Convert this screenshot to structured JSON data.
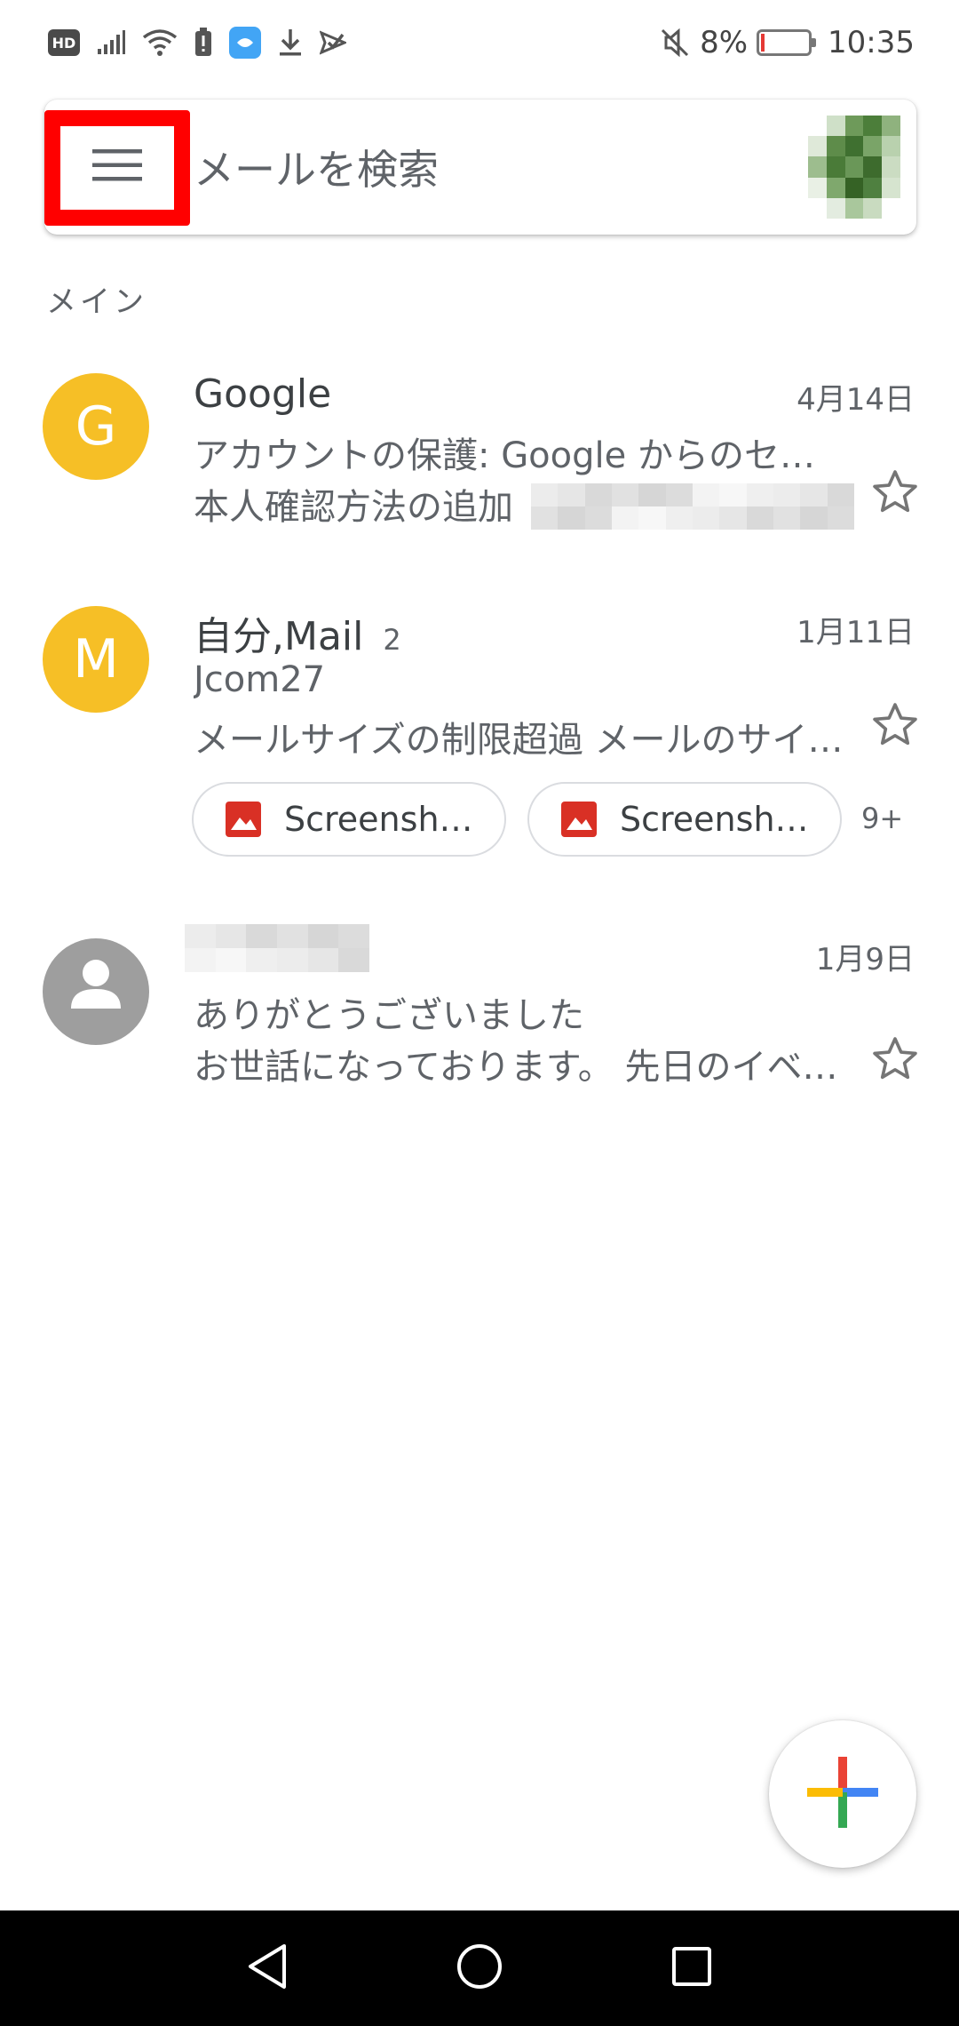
{
  "status_bar": {
    "left_icons": [
      "hd-icon",
      "signal-icon",
      "wifi-icon",
      "alert-battery-icon",
      "app-notification-icon",
      "download-icon",
      "send-check-icon"
    ],
    "hd_label": "HD",
    "battery_percent": "8%",
    "battery_level": 0.08,
    "time": "10:35",
    "mute_icon": "mute-icon"
  },
  "search": {
    "placeholder": "メールを検索",
    "menu_icon": "menu-icon",
    "account_avatar": "account-avatar"
  },
  "section": {
    "label": "メイン"
  },
  "mails": [
    {
      "avatar_letter": "G",
      "avatar_color": "#F6BF26",
      "sender": "Google",
      "count": "",
      "date": "4月14日",
      "subject": "アカウントの保護: Google からのセ…",
      "snippet": "本人確認方法の追加",
      "starred": false
    },
    {
      "avatar_letter": "M",
      "avatar_color": "#F6BF26",
      "sender": "自分,Mail",
      "count": "2",
      "date": "1月11日",
      "subject": "Jcom27",
      "snippet": "メールサイズの制限超過 メールのサイ…",
      "attachments": [
        "Screensh…",
        "Screensh…"
      ],
      "more_attachments": "9+",
      "starred": false
    },
    {
      "avatar_letter": "",
      "avatar_color": "#9E9E9E",
      "sender": "",
      "count": "",
      "date": "1月9日",
      "subject": "ありがとうございました",
      "snippet": "お世話になっております。 先日のイベ…",
      "starred": false
    }
  ],
  "fab": {
    "icon": "compose-plus-icon"
  },
  "nav": {
    "back_icon": "back-icon",
    "home_icon": "home-icon",
    "recents_icon": "recents-icon"
  },
  "colors": {
    "highlight": "#FF0000",
    "avatar_yellow": "#F6BF26",
    "avatar_gray": "#9E9E9E",
    "attachment_red": "#D93025"
  }
}
